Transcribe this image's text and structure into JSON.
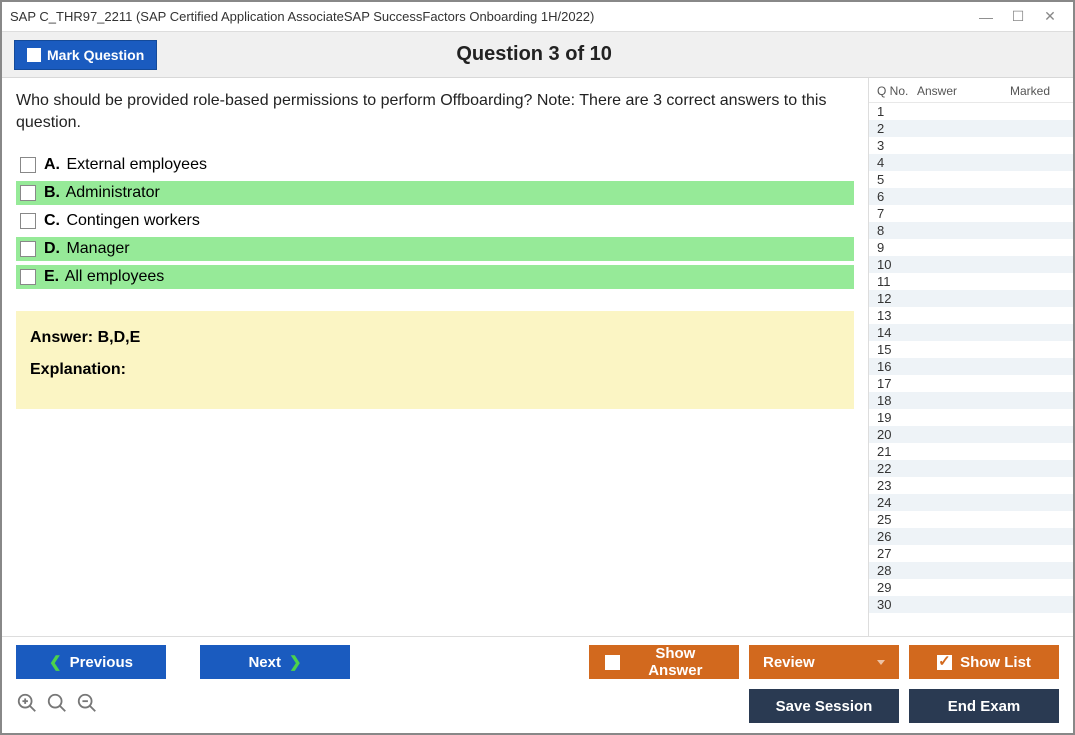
{
  "window_title": "SAP C_THR97_2211 (SAP Certified Application AssociateSAP SuccessFactors Onboarding 1H/2022)",
  "mark_button": "Mark Question",
  "header_title": "Question 3 of 10",
  "question_text": "Who should be provided role-based permissions to perform Offboarding? Note: There are 3 correct answers to this question.",
  "options": [
    {
      "letter": "A.",
      "text": "External employees",
      "correct": false
    },
    {
      "letter": "B.",
      "text": "Administrator",
      "correct": true
    },
    {
      "letter": "C.",
      "text": "Contingen workers",
      "correct": false
    },
    {
      "letter": "D.",
      "text": "Manager",
      "correct": true
    },
    {
      "letter": "E.",
      "text": "All employees",
      "correct": true
    }
  ],
  "answer_label": "Answer:",
  "answer_value": "B,D,E",
  "explanation_label": "Explanation:",
  "side": {
    "h_qno": "Q No.",
    "h_ans": "Answer",
    "h_mark": "Marked",
    "rows": 30
  },
  "buttons": {
    "previous": "Previous",
    "next": "Next",
    "show_answer": "Show Answer",
    "review": "Review",
    "show_list": "Show List",
    "save_session": "Save Session",
    "end_exam": "End Exam"
  }
}
